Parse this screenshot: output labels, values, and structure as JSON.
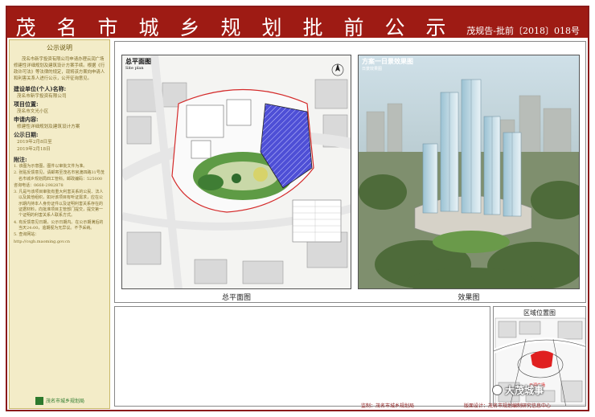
{
  "header": {
    "title": "茂名市城乡规划批前公示",
    "doc_number": "茂规告-批前〔2018〕018号",
    "bar_color": "#9e1b14"
  },
  "sidebar": {
    "heading": "公示说明",
    "intro": "茂名市新宇投资有限公司申请办理云润广场修建性详细规划及建筑设计方案手续。根据《行政许可法》等法律的规定，现将该方案向申请人和利害关系人进行公示，公开征询意见。",
    "items": [
      {
        "label": "建设单位(个人)名称:",
        "value": "茂名市新宇投资有限公司"
      },
      {
        "label": "项目位置:",
        "value": "茂名市文光小区"
      },
      {
        "label": "申请内容:",
        "value": "修建性详细规划及建筑设计方案"
      },
      {
        "label": "公示日期:",
        "value": "2019年2月8日至"
      },
      {
        "label": "",
        "value": "2019年2月18日"
      }
    ],
    "notes_label": "附注:",
    "notes": [
      "1. 该图为示意图，图件以审批文件为准。",
      "2. 张贴反馈意见，请邮寄至茂名市官渡四路31号茂名市城乡规划局四工管科。邮政编码：525000",
      "   咨询电话：0668-2982878",
      "3. 凡是与该项目审批有重大利害关系的公民、法人以及其他组织，如对该项目有听证需求，应在公示期内持本人身份证件以及证明利害关系存在的证据材料，向批准项目主管部门提交，提交第一个证明的利害关系人联系方式。",
      "4. 有反馈意见日期，公示日期内。在公示期满后的当天24:00，逾期视为无异议。不予采纳。",
      "5. 查询网站：",
      "   http://csgh.maoming.gov.cn"
    ],
    "footer": "茂名市城乡规划局"
  },
  "main": {
    "plan": {
      "title": "总平面图",
      "subtitle": "Site plan",
      "caption": "总平面图"
    },
    "render": {
      "title": "方案一日景效果图",
      "subtitle": "日景效果图",
      "caption": "效果图"
    }
  },
  "location": {
    "title": "区域位置图",
    "marker_label": "云润广场",
    "accent": "#e02020"
  },
  "credits": {
    "supervisor": "监制：茂名市城乡规划局",
    "designer": "版面设计：茂名市规划编制研究信息中心"
  },
  "watermark": "大茂城事"
}
